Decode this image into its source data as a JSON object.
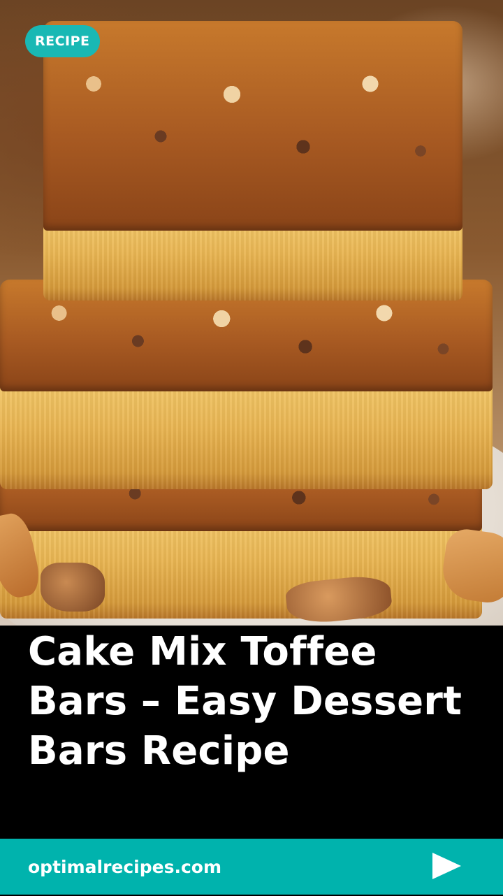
{
  "category": "RECIPE",
  "title": "Cake Mix Toffee Bars – Easy Dessert Bars Recipe",
  "site": "optimalrecipes.com",
  "icons": {
    "next": "play-arrow-icon"
  },
  "colors": {
    "accent": "#19b8b4",
    "footer_bg": "#00b3ad",
    "title_bg": "#000000",
    "text": "#ffffff"
  }
}
